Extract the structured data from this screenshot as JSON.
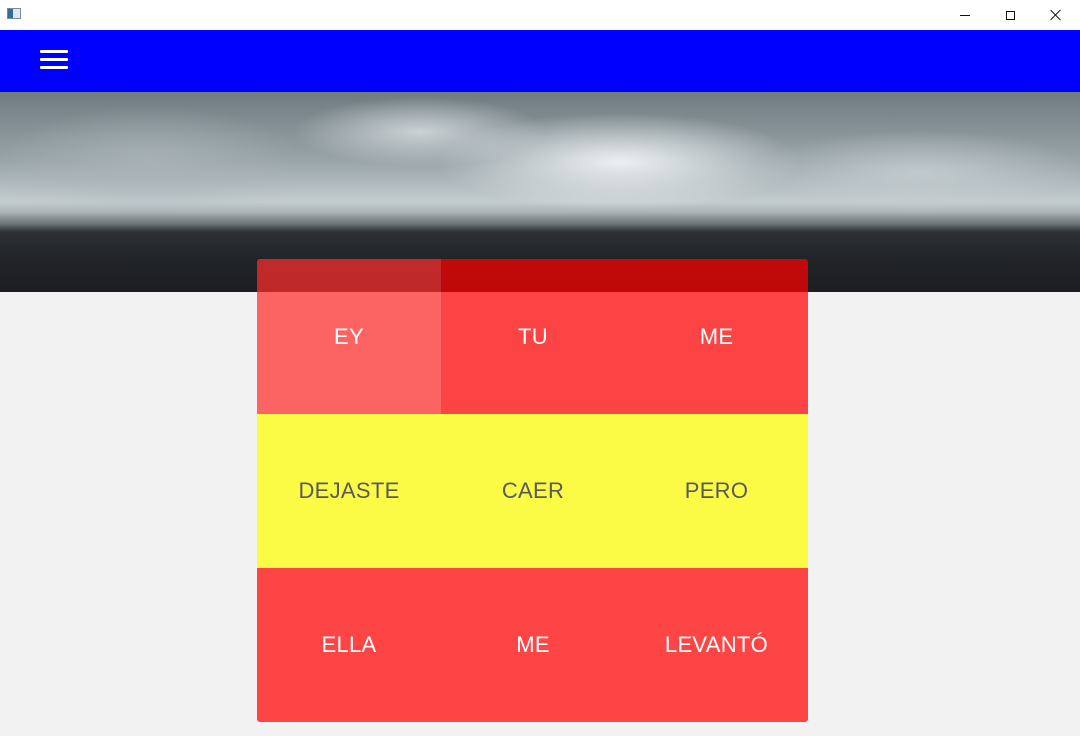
{
  "window": {
    "title": ""
  },
  "appbar": {
    "menu_icon": "hamburger-menu-icon",
    "color": "#0000ff"
  },
  "banner": {
    "image": "stormy-sky-landscape"
  },
  "tiles": [
    {
      "label": "EY",
      "color": "#f95c5f",
      "state": "selected"
    },
    {
      "label": "TU",
      "color": "#fe4545"
    },
    {
      "label": "ME",
      "color": "#fe4545"
    },
    {
      "label": "DEJASTE",
      "color": "#fbfb45"
    },
    {
      "label": "CAER",
      "color": "#fbfb45"
    },
    {
      "label": "PERO",
      "color": "#fbfb45"
    },
    {
      "label": "ELLA",
      "color": "#fe4545"
    },
    {
      "label": "ME",
      "color": "#fe4545"
    },
    {
      "label": "LEVANTÓ",
      "color": "#fe4545"
    }
  ]
}
